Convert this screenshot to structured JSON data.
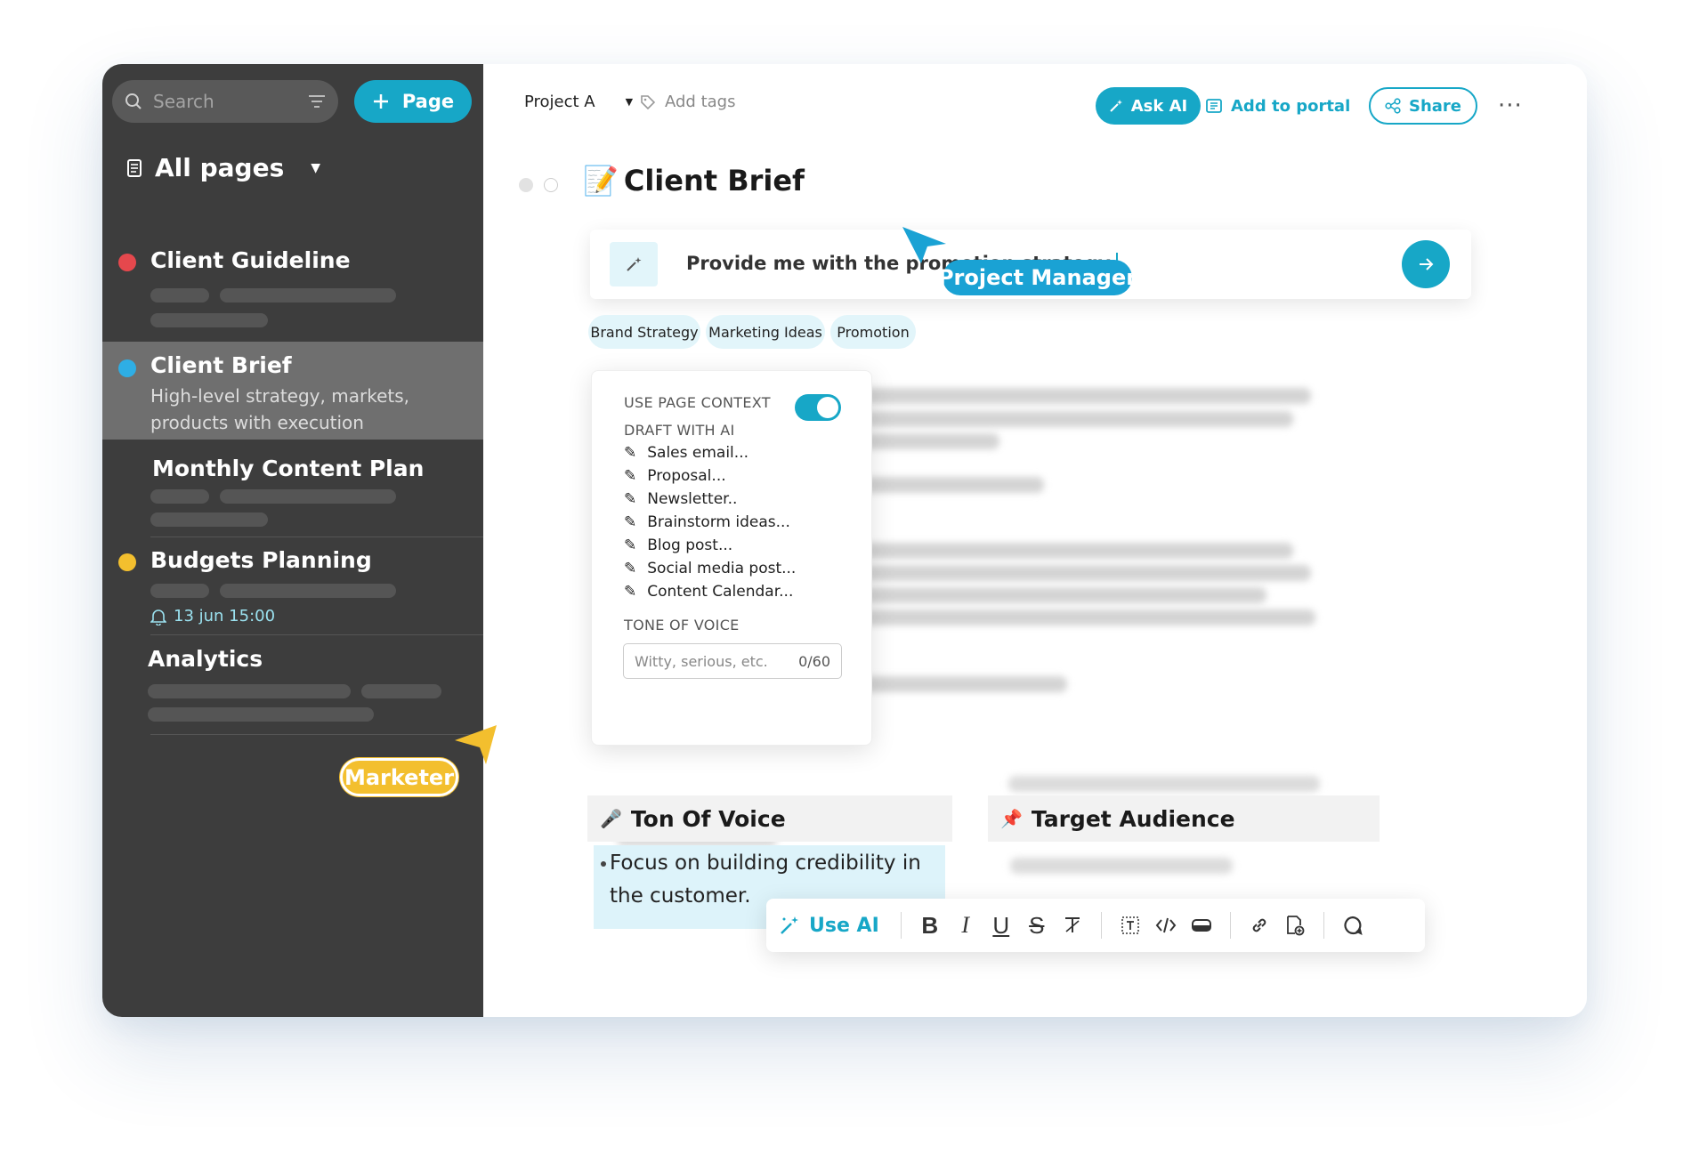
{
  "sidebar": {
    "search_placeholder": "Search",
    "new_page_label": "Page",
    "all_pages_label": "All pages",
    "items": [
      {
        "title": "Client Guideline",
        "dot_color": "#e5484d"
      },
      {
        "title": "Client Brief",
        "dot_color": "#2eaee5",
        "description": "High-level strategy, markets, products with execution"
      },
      {
        "title": "Monthly Content Plan"
      },
      {
        "title": "Budgets Planning",
        "dot_color": "#f3bf2e",
        "reminder": "13 jun 15:00"
      },
      {
        "title": "Analytics"
      }
    ]
  },
  "header": {
    "project": "Project A",
    "add_tags": "Add tags",
    "ask_ai": "Ask AI",
    "add_to_portal": "Add to portal",
    "share": "Share"
  },
  "doc": {
    "title_emoji": "📝",
    "title": "Client Brief"
  },
  "prompt": {
    "text": "Provide me with the promotion strategy"
  },
  "chips": [
    "Brand Strategy",
    "Marketing Ideas",
    "Promotion"
  ],
  "dropdown": {
    "use_page_context": "USE PAGE CONTEXT",
    "draft_with_ai": "DRAFT WITH AI",
    "options": [
      "Sales email...",
      "Proposal...",
      "Newsletter..",
      "Brainstorm ideas...",
      "Blog post...",
      "Social media post...",
      "Content Calendar..."
    ],
    "tone_of_voice": "TONE OF VOICE",
    "tone_placeholder": "Witty, serious, etc.",
    "tone_count": "0/60"
  },
  "sections": {
    "tone_emoji": "🎤",
    "tone": "Ton Of Voice",
    "audience_emoji": "📌",
    "audience": "Target Audience",
    "tone_bullet": "Focus on building credibility in the customer."
  },
  "format_bar": {
    "use_ai": "Use AI",
    "bold": "B",
    "italic": "I",
    "underline": "U",
    "strike": "S"
  },
  "overlays": {
    "project_manager": "Project Manager",
    "marketer": "Marketer"
  },
  "colors": {
    "accent": "#17a7c7",
    "sidebar_bg": "#3d3d3d",
    "pm_tag": "#1aa2d4",
    "marketer_tag": "#f3bf2e"
  }
}
